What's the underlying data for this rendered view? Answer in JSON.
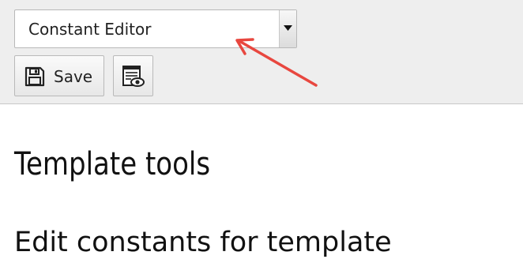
{
  "toolbar": {
    "function_select": {
      "selected": "Constant Editor"
    },
    "save_button": {
      "label": "Save",
      "icon": "save-icon"
    },
    "view_button": {
      "icon": "view-webpage-icon"
    }
  },
  "annotation": {
    "arrow_color": "#e8473f"
  },
  "content": {
    "title": "Template tools",
    "subtitle": "Edit constants for template"
  },
  "colors": {
    "toolbar_bg": "#eeeeee",
    "page_bg": "#ffffff"
  }
}
